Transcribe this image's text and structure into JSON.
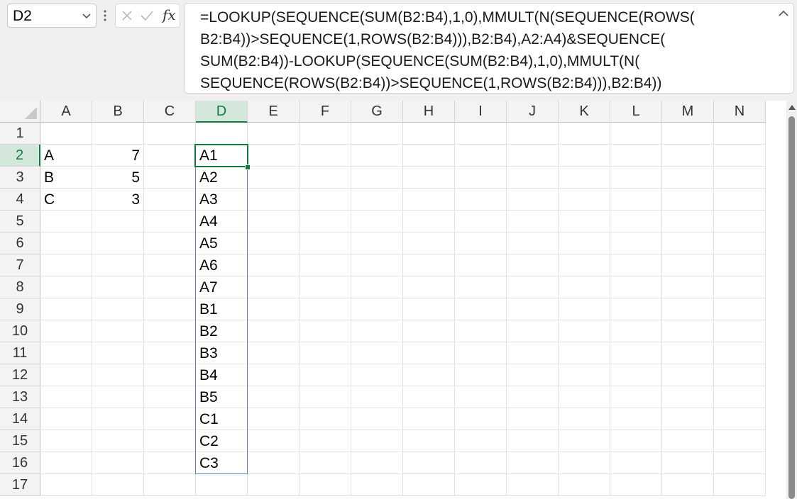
{
  "name_box": {
    "value": "D2",
    "chevron_icon": "chevron-down-icon"
  },
  "formula_bar": {
    "cancel_icon": "close-icon",
    "enter_icon": "checkmark-icon",
    "fx_label": "fx",
    "formula": "=LOOKUP(SEQUENCE(SUM(B2:B4),1,0),MMULT(N(SEQUENCE(ROWS(B2:B4))>SEQUENCE(1,ROWS(B2:B4))),B2:B4),A2:A4)&SEQUENCE(SUM(B2:B4))-LOOKUP(SEQUENCE(SUM(B2:B4),1,0),MMULT(N(SEQUENCE(ROWS(B2:B4))>SEQUENCE(1,ROWS(B2:B4))),B2:B4))",
    "formula_lines": [
      "=LOOKUP(SEQUENCE(SUM(B2:B4),1,0),MMULT(N(SEQUENCE(ROWS(",
      "B2:B4))>SEQUENCE(1,ROWS(B2:B4))),B2:B4),A2:A4)&SEQUENCE(",
      "SUM(B2:B4))-LOOKUP(SEQUENCE(SUM(B2:B4),1,0),MMULT(N(",
      "SEQUENCE(ROWS(B2:B4))>SEQUENCE(1,ROWS(B2:B4))),B2:B4))"
    ],
    "collapse_icon": "chevron-up-icon"
  },
  "sheet": {
    "columns": [
      "A",
      "B",
      "C",
      "D",
      "E",
      "F",
      "G",
      "H",
      "I",
      "J",
      "K",
      "L",
      "M",
      "N"
    ],
    "rows": [
      "1",
      "2",
      "3",
      "4",
      "5",
      "6",
      "7",
      "8",
      "9",
      "10",
      "11",
      "12",
      "13",
      "14",
      "15",
      "16",
      "17"
    ],
    "selected_column": "D",
    "selected_row": "2",
    "cells": {
      "A2": "A",
      "B2": "7",
      "A3": "B",
      "B3": "5",
      "A4": "C",
      "B4": "3",
      "D2": "A1",
      "D3": "A2",
      "D4": "A3",
      "D5": "A4",
      "D6": "A5",
      "D7": "A6",
      "D8": "A7",
      "D9": "B1",
      "D10": "B2",
      "D11": "B3",
      "D12": "B4",
      "D13": "B5",
      "D14": "C1",
      "D15": "C2",
      "D16": "C3"
    }
  },
  "colors": {
    "selection_green": "#107c41",
    "spill_border": "#5b7fc7",
    "header_highlight": "#d3e7da"
  }
}
